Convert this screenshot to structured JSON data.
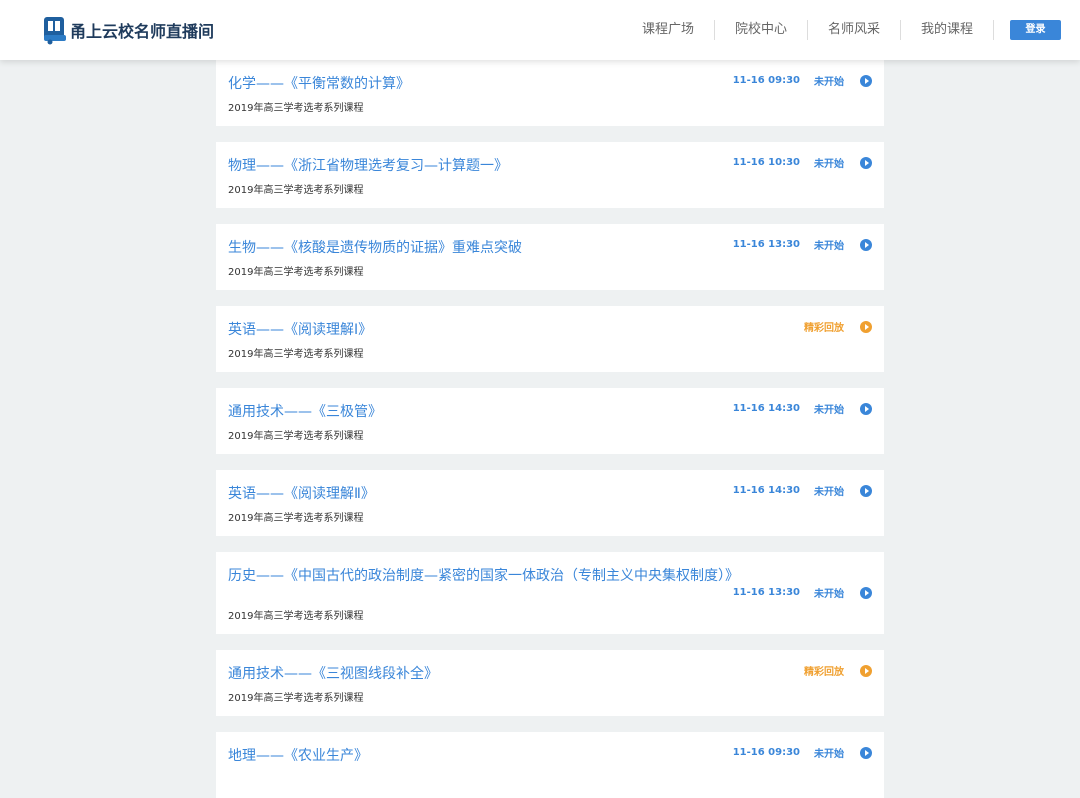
{
  "header": {
    "logo_text": "甬上云校名师直播间",
    "nav": [
      "课程广场",
      "院校中心",
      "名师风采",
      "我的课程"
    ],
    "login_label": "登录"
  },
  "colors": {
    "accent": "#3a86d9",
    "replay": "#f0a030",
    "background": "#eef1f2"
  },
  "courses": [
    {
      "title": "化学——《平衡常数的计算》",
      "subtitle": "2019年高三学考选考系列课程",
      "time": "11-16 09:30",
      "status": "未开始",
      "state": "upcoming"
    },
    {
      "title": "物理——《浙江省物理选考复习—计算题一》",
      "subtitle": "2019年高三学考选考系列课程",
      "time": "11-16 10:30",
      "status": "未开始",
      "state": "upcoming"
    },
    {
      "title": "生物——《核酸是遗传物质的证据》重难点突破",
      "subtitle": "2019年高三学考选考系列课程",
      "time": "11-16 13:30",
      "status": "未开始",
      "state": "upcoming"
    },
    {
      "title": "英语——《阅读理解Ⅰ》",
      "subtitle": "2019年高三学考选考系列课程",
      "time": "",
      "status": "精彩回放",
      "state": "replay"
    },
    {
      "title": "通用技术——《三极管》",
      "subtitle": "2019年高三学考选考系列课程",
      "time": "11-16 14:30",
      "status": "未开始",
      "state": "upcoming"
    },
    {
      "title": "英语——《阅读理解Ⅱ》",
      "subtitle": "2019年高三学考选考系列课程",
      "time": "11-16 14:30",
      "status": "未开始",
      "state": "upcoming"
    },
    {
      "title": "历史——《中国古代的政治制度—紧密的国家一体政治（专制主义中央集权制度）》",
      "subtitle": "2019年高三学考选考系列课程",
      "time": "11-16 13:30",
      "status": "未开始",
      "state": "upcoming"
    },
    {
      "title": "通用技术——《三视图线段补全》",
      "subtitle": "2019年高三学考选考系列课程",
      "time": "",
      "status": "精彩回放",
      "state": "replay"
    },
    {
      "title": "地理——《农业生产》",
      "subtitle": "",
      "time": "11-16 09:30",
      "status": "未开始",
      "state": "upcoming"
    }
  ]
}
